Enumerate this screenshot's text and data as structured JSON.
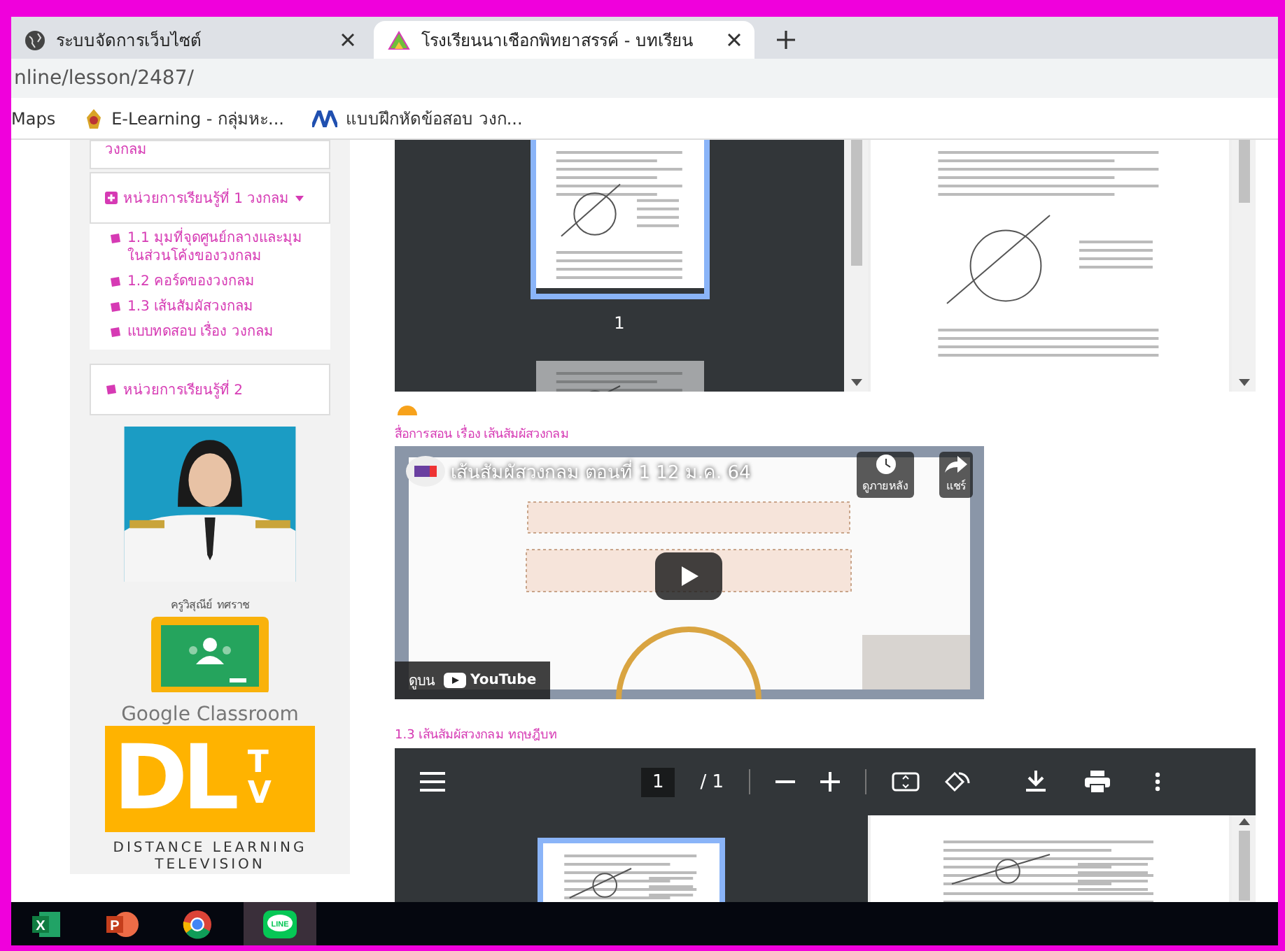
{
  "browser": {
    "tabs": [
      {
        "title": "ระบบจัดการเว็บไซต์",
        "selected": false
      },
      {
        "title": "โรงเรียนนาเชือกพิทยาสรรค์ - บทเรียน",
        "selected": true
      }
    ],
    "address": "nline/lesson/2487/",
    "bookmarks": [
      {
        "label": "Maps"
      },
      {
        "label": "E-Learning - กลุ่มหะ..."
      },
      {
        "label": "แบบฝึกหัดข้อสอบ วงก..."
      }
    ]
  },
  "sidebar": {
    "partial_text": "วงกลม",
    "units": [
      {
        "title": "หน่วยการเรียนรู้ที่ 1 วงกลม",
        "expanded": true,
        "lessons": [
          "1.1 มุมที่จุดศูนย์กลางและมุมในส่วนโค้งของวงกลม",
          "1.2 คอร์ดของวงกลม",
          "1.3 เส้นสัมผัสวงกลม",
          "แบบทดสอบ เรื่อง วงกลม"
        ]
      },
      {
        "title": "หน่วยการเรียนรู้ที่ 2",
        "expanded": false
      }
    ],
    "teacher_name": "ครูวิสุณีย์ ทศราช",
    "classroom_label": "Google Classroom",
    "dltv": {
      "letters": "DL",
      "tv_top": "T",
      "tv_bottom": "V",
      "caption_1": "DISTANCE LEARNING",
      "caption_2": "TELEVISION"
    }
  },
  "main": {
    "top_pdf": {
      "thumbnail_page": "1"
    },
    "media_title": "สื่อการสอน เรื่อง เส้นสัมผัสวงกลม",
    "video": {
      "title": "เส้นสัมผัสวงกลม ตอนที่ 1 12 ม.ค. 64",
      "watch_later": "ดูภายหลัง",
      "share": "แชร์",
      "watch_on": "ดูบน",
      "youtube": "YouTube"
    },
    "pdf_title": "1.3  เส้นสัมผัสวงกลม ทฤษฎีบท",
    "pdf_viewer": {
      "page": "1",
      "total": "/ 1"
    }
  },
  "taskbar": {
    "apps": [
      {
        "kind": "excel",
        "mark": "X"
      },
      {
        "kind": "powerpoint",
        "mark": "P"
      },
      {
        "kind": "chrome"
      },
      {
        "kind": "line",
        "mark": "LINE"
      }
    ]
  }
}
